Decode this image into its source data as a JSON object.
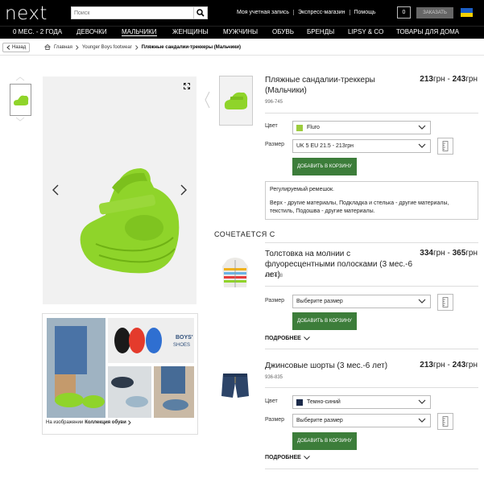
{
  "header": {
    "logo": "next",
    "search_placeholder": "Поиск",
    "links": [
      "Моя учетная запись",
      "Экспресс-магазин",
      "Помощь"
    ],
    "bag_count": "0",
    "checkout_label": "ЗАКАЗАТЬ"
  },
  "nav": {
    "items": [
      "0 МЕС. - 2 ГОДА",
      "ДЕВОЧКИ",
      "МАЛЬЧИКИ",
      "ЖЕНЩИНЫ",
      "МУЖЧИНЫ",
      "ОБУВЬ",
      "БРЕНДЫ",
      "LIPSY & CO",
      "ТОВАРЫ ДЛЯ ДОМА"
    ],
    "active": "МАЛЬЧИКИ"
  },
  "breadcrumb": {
    "back_label": "Назад",
    "items": [
      "Главная",
      "Younger Boys footwear",
      "Пляжные сандалии-треккеры (Мальчики)"
    ]
  },
  "gallery": {
    "collection_caption_prefix": "На изображении",
    "collection_caption_name": "Коллекция обуви",
    "promo_text": "BOYS' SHOES"
  },
  "product": {
    "title": "Пляжные сандалии-треккеры (Мальчики)",
    "code": "996-745",
    "price_from": "213",
    "price_to": "243",
    "currency": "грн",
    "color_label": "Цвет",
    "color_value": "Fluro",
    "color_swatch": "#9ccc3d",
    "size_label": "Размер",
    "size_value": "UK 5 EU 21.5 - 213грн",
    "add_label": "ДОБАВИТЬ В КОРЗИНУ",
    "desc_1": "Регулируемый ремешок.",
    "desc_2": "Верх - другие материалы, Подкладка и стелька - другие материалы, текстиль, Подошва - другие материалы."
  },
  "complete_look": {
    "heading": "СОЧЕТАЕТСЯ С",
    "items": [
      {
        "title": "Толстовка на молнии с флуоресцентными полосками (3 мес.-6 лет)",
        "code": "421-638",
        "price_from": "334",
        "price_to": "365",
        "size_label": "Размер",
        "size_value": "Выберите размер",
        "add_label": "ДОБАВИТЬ В КОРЗИНУ",
        "more_label": "ПОДРОБНЕЕ"
      },
      {
        "title": "Джинсовые шорты (3 мес.-6 лет)",
        "code": "936-835",
        "price_from": "213",
        "price_to": "243",
        "color_label": "Цвет",
        "color_value": "Темно-синий",
        "color_swatch": "#1b2a4a",
        "size_label": "Размер",
        "size_value": "Выберите размер",
        "add_label": "ДОБАВИТЬ В КОРЗИНУ",
        "more_label": "ПОДРОБНЕЕ"
      }
    ]
  },
  "colors": {
    "header_bg": "#000000",
    "add_button": "#3c7d3a",
    "sandal_green": "#8fd42a"
  }
}
